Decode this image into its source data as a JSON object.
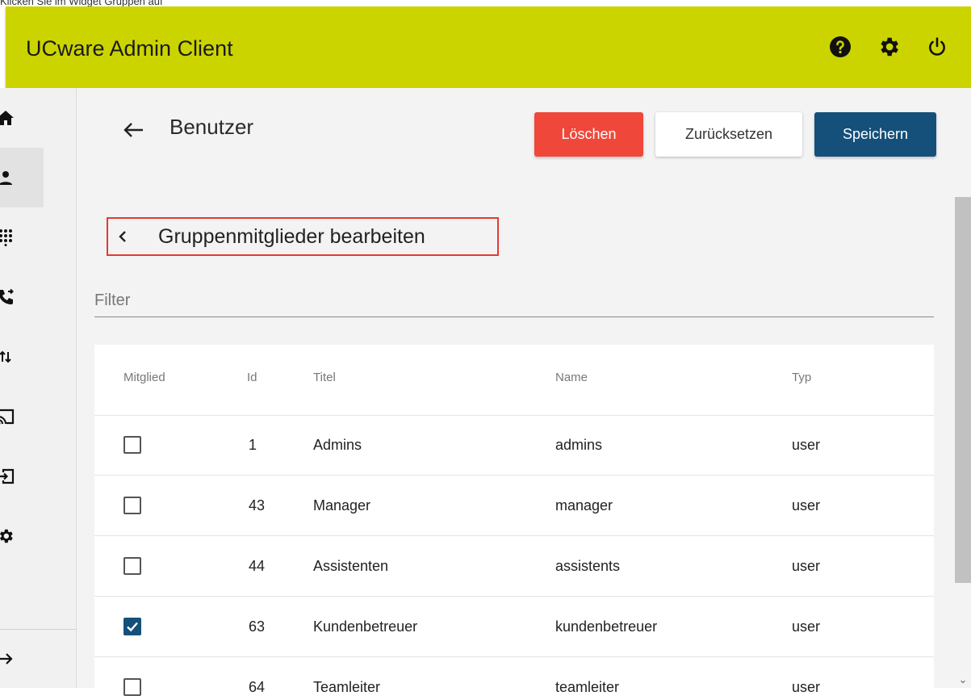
{
  "caption": "Klicken Sie im Widget Gruppen auf",
  "topbar": {
    "title": "UCware Admin Client",
    "color": "#ccd400",
    "icons": [
      "help-icon",
      "settings-icon",
      "power-icon"
    ]
  },
  "sidebar": {
    "active_index": 1,
    "items": [
      "home-icon",
      "user-icon",
      "dialpad-icon",
      "call-forward-icon",
      "transfer-icon",
      "cast-icon",
      "login-icon",
      "settings-icon"
    ],
    "bottom_icon": "arrow-right-icon"
  },
  "header": {
    "title": "Benutzer",
    "buttons": {
      "delete": "Löschen",
      "reset": "Zurücksetzen",
      "save": "Speichern"
    },
    "colors": {
      "delete": "#ef473a",
      "save": "#15507a"
    }
  },
  "section": {
    "title": "Gruppenmitglieder bearbeiten"
  },
  "filter": {
    "placeholder": "Filter",
    "value": ""
  },
  "table": {
    "columns": [
      "Mitglied",
      "Id",
      "Titel",
      "Name",
      "Typ"
    ],
    "rows": [
      {
        "member": false,
        "id": "1",
        "title": "Admins",
        "name": "admins",
        "type": "user"
      },
      {
        "member": false,
        "id": "43",
        "title": "Manager",
        "name": "manager",
        "type": "user"
      },
      {
        "member": false,
        "id": "44",
        "title": "Assistenten",
        "name": "assistents",
        "type": "user"
      },
      {
        "member": true,
        "id": "63",
        "title": "Kundenbetreuer",
        "name": "kundenbetreuer",
        "type": "user"
      },
      {
        "member": false,
        "id": "64",
        "title": "Teamleiter",
        "name": "teamleiter",
        "type": "user"
      }
    ]
  }
}
